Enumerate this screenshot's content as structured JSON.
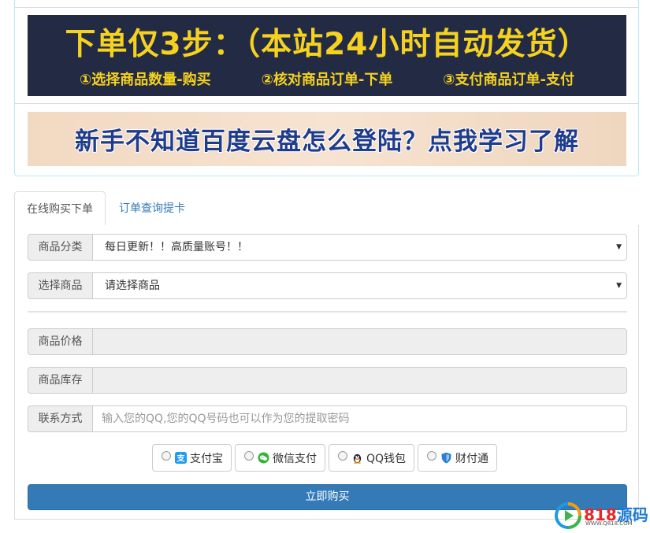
{
  "banner_steps": {
    "headline": "下单仅3步：（本站24小时自动发货）",
    "steps": [
      "①选择商品数量-购买",
      "②核对商品订单-下单",
      "③支付商品订单-支付"
    ]
  },
  "banner_help": {
    "text": "新手不知道百度云盘怎么登陆？点我学习了解"
  },
  "tabs": [
    {
      "label": "在线购买下单",
      "active": true
    },
    {
      "label": "订单查询提卡",
      "active": false
    }
  ],
  "form": {
    "category": {
      "label": "商品分类",
      "value": "每日更新！！高质量账号！！"
    },
    "product": {
      "label": "选择商品",
      "value": "请选择商品"
    },
    "price": {
      "label": "商品价格",
      "value": ""
    },
    "stock": {
      "label": "商品库存",
      "value": ""
    },
    "contact": {
      "label": "联系方式",
      "placeholder": "输入您的QQ,您的QQ号码也可以作为您的提取密码"
    }
  },
  "payment_methods": [
    {
      "label": "支付宝",
      "icon": "alipay-icon",
      "color": "#1b9cf0"
    },
    {
      "label": "微信支付",
      "icon": "wechat-icon",
      "color": "#35b33b"
    },
    {
      "label": "QQ钱包",
      "icon": "qq-penguin-icon",
      "color": "#222222"
    },
    {
      "label": "财付通",
      "icon": "tenpay-shield-icon",
      "color": "#2d7dd2"
    }
  ],
  "buy_button": {
    "label": "立即购买"
  },
  "watermark": {
    "brand_num": "818",
    "brand_cn": "源码",
    "url": "WWW.Q818.COM"
  },
  "colors": {
    "primary": "#337ab7",
    "banner_bg": "#232a44",
    "banner_text": "#f5d21f",
    "help_text": "#1f3c8c"
  }
}
